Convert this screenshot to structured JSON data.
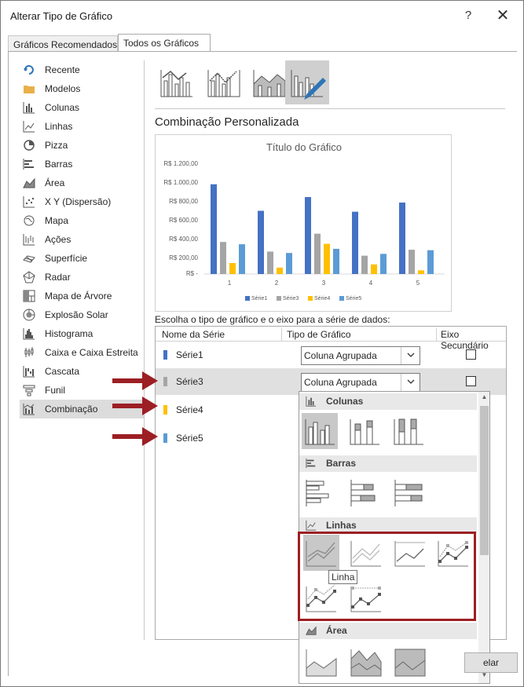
{
  "window": {
    "title": "Alterar Tipo de Gráfico",
    "help_label": "?",
    "close_label": "✕"
  },
  "tabs": [
    "Gráficos Recomendados",
    "Todos os Gráficos"
  ],
  "sidebar": [
    {
      "label": "Recente",
      "icon": "recent-icon"
    },
    {
      "label": "Modelos",
      "icon": "folder-icon"
    },
    {
      "label": "Colunas",
      "icon": "column-chart-icon"
    },
    {
      "label": "Linhas",
      "icon": "line-chart-icon"
    },
    {
      "label": "Pizza",
      "icon": "pie-chart-icon"
    },
    {
      "label": "Barras",
      "icon": "bar-chart-icon"
    },
    {
      "label": "Área",
      "icon": "area-chart-icon"
    },
    {
      "label": "X Y (Dispersão)",
      "icon": "scatter-chart-icon"
    },
    {
      "label": "Mapa",
      "icon": "map-chart-icon"
    },
    {
      "label": "Ações",
      "icon": "stock-chart-icon"
    },
    {
      "label": "Superfície",
      "icon": "surface-chart-icon"
    },
    {
      "label": "Radar",
      "icon": "radar-chart-icon"
    },
    {
      "label": "Mapa de Árvore",
      "icon": "treemap-chart-icon"
    },
    {
      "label": "Explosão Solar",
      "icon": "sunburst-chart-icon"
    },
    {
      "label": "Histograma",
      "icon": "histogram-chart-icon"
    },
    {
      "label": "Caixa e Caixa Estreita",
      "icon": "box-whisker-chart-icon"
    },
    {
      "label": "Cascata",
      "icon": "waterfall-chart-icon"
    },
    {
      "label": "Funil",
      "icon": "funnel-chart-icon"
    },
    {
      "label": "Combinação",
      "icon": "combo-chart-icon",
      "active": true
    }
  ],
  "main": {
    "section_title": "Combinação Personalizada",
    "instruction": "Escolha o tipo de gráfico e o eixo para a série de dados:",
    "columns": {
      "name": "Nome da Série",
      "type": "Tipo de Gráfico",
      "axis": "Eixo Secundário"
    }
  },
  "series_rows": [
    {
      "name": "Série1",
      "color": "#4472C4",
      "type": "Coluna Agrupada",
      "secondary": false
    },
    {
      "name": "Série3",
      "color": "#A5A5A5",
      "type": "Coluna Agrupada",
      "secondary": false
    },
    {
      "name": "Série4",
      "color": "#FFC000"
    },
    {
      "name": "Série5",
      "color": "#5B9BD5"
    }
  ],
  "chart_data": {
    "type": "bar",
    "title": "Título do Gráfico",
    "categories": [
      "1",
      "2",
      "3",
      "4",
      "5"
    ],
    "ytick_labels": [
      "R$ 1.200,00",
      "R$ 1.000,00",
      "R$ 800,00",
      "R$ 600,00",
      "R$ 400,00",
      "R$ 200,00",
      "R$ -"
    ],
    "ylim": [
      0,
      1200
    ],
    "series": [
      {
        "name": "Série1",
        "color": "#4472C4",
        "values": [
          980,
          690,
          840,
          680,
          780
        ]
      },
      {
        "name": "Série3",
        "color": "#A5A5A5",
        "values": [
          350,
          245,
          440,
          200,
          265
        ]
      },
      {
        "name": "Série4",
        "color": "#FFC000",
        "values": [
          120,
          70,
          330,
          105,
          40
        ]
      },
      {
        "name": "Série5",
        "color": "#5B9BD5",
        "values": [
          325,
          230,
          275,
          220,
          260
        ]
      }
    ],
    "legend_position": "bottom",
    "grid": false
  },
  "dropdown": {
    "sections": [
      {
        "label": "Colunas",
        "icon": "column-chart-icon"
      },
      {
        "label": "Barras",
        "icon": "bar-chart-icon"
      },
      {
        "label": "Linhas",
        "icon": "line-chart-icon"
      },
      {
        "label": "Área",
        "icon": "area-chart-icon"
      }
    ],
    "tooltip": "Linha"
  },
  "buttons": {
    "cancel_partial": "elar"
  },
  "colors": {
    "highlight_border": "#9c1f24",
    "arrow": "#9c1f24"
  }
}
